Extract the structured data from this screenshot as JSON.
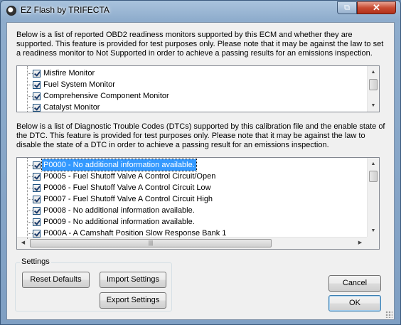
{
  "window": {
    "title": "EZ Flash by TRIFECTA",
    "restore_glyph": "⧉",
    "close_glyph": "✕"
  },
  "monitors": {
    "description": "Below is a list of reported OBD2 readiness monitors supported by this ECM and whether they are supported.  This feature is provided for test purposes only.  Please note that it may be against the law to set a readiness monitor to Not Supported in order to achieve a passing results for an emissions inspection.",
    "items": [
      {
        "label": "Misfire Monitor",
        "checked": true
      },
      {
        "label": "Fuel System Monitor",
        "checked": true
      },
      {
        "label": "Comprehensive Component Monitor",
        "checked": true
      },
      {
        "label": "Catalyst Monitor",
        "checked": true
      }
    ]
  },
  "dtcs": {
    "description": "Below is a list of Diagnostic Trouble Codes (DTCs) supported by this calibration file and the enable state of the DTC.  This feature is provided for test purposes only.  Please note that it may be against the law to disable the state of a DTC in order to achieve a passing result for an emissions inspection.",
    "items": [
      {
        "label": "P0000 - No additional information available.",
        "checked": true,
        "selected": true
      },
      {
        "label": "P0005 - Fuel Shutoff Valve A Control Circuit/Open",
        "checked": true
      },
      {
        "label": "P0006 - Fuel Shutoff Valve A Control Circuit Low",
        "checked": true
      },
      {
        "label": "P0007 - Fuel Shutoff Valve A Control Circuit High",
        "checked": true
      },
      {
        "label": "P0008 - No additional information available.",
        "checked": true
      },
      {
        "label": "P0009 - No additional information available.",
        "checked": true
      },
      {
        "label": "P000A - A Camshaft Position Slow Response Bank 1",
        "checked": true
      }
    ]
  },
  "settings": {
    "group_label": "Settings",
    "reset_label": "Reset Defaults",
    "import_label": "Import Settings",
    "export_label": "Export Settings"
  },
  "dialog": {
    "cancel_label": "Cancel",
    "ok_label": "OK"
  },
  "scroll_glyphs": {
    "up": "▲",
    "down": "▼",
    "left": "◀",
    "right": "▶",
    "grip": "|||"
  }
}
